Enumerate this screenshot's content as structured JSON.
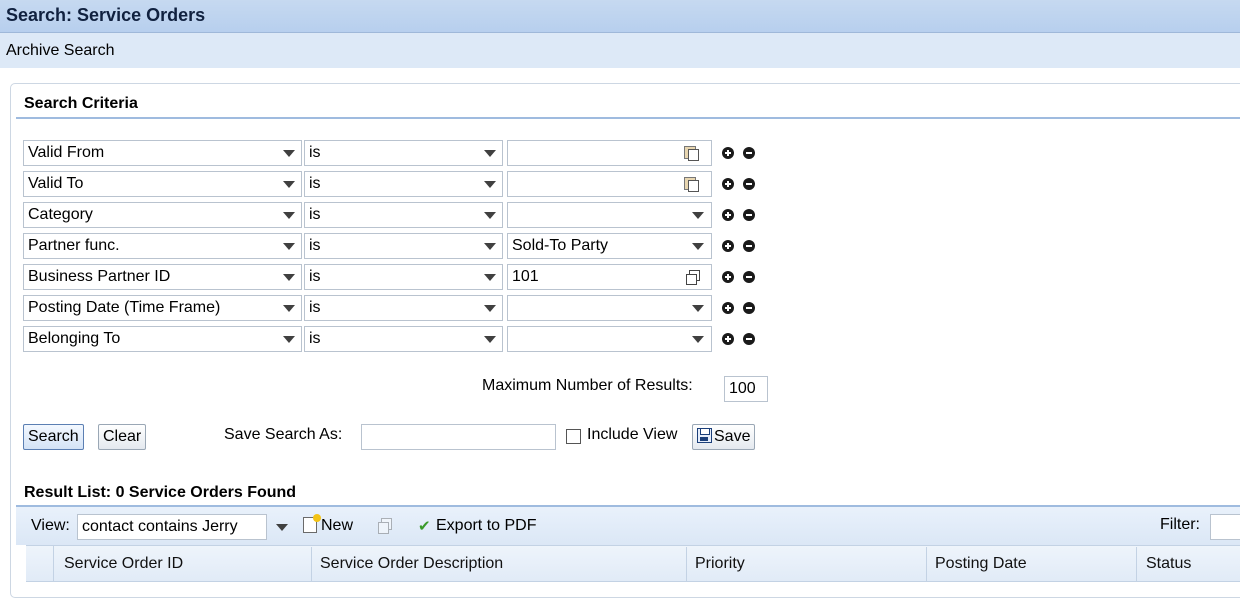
{
  "header": {
    "title": "Search: Service Orders",
    "subtitle": "Archive Search"
  },
  "search_criteria": {
    "title": "Search Criteria",
    "rows": [
      {
        "field": "Valid From",
        "operator": "is",
        "value": "",
        "value_type": "date"
      },
      {
        "field": "Valid To",
        "operator": "is",
        "value": "",
        "value_type": "date"
      },
      {
        "field": "Category",
        "operator": "is",
        "value": "",
        "value_type": "dropdown"
      },
      {
        "field": "Partner func.",
        "operator": "is",
        "value": "Sold-To Party",
        "value_type": "dropdown"
      },
      {
        "field": "Business Partner ID",
        "operator": "is",
        "value": "101",
        "value_type": "lookup"
      },
      {
        "field": "Posting Date (Time Frame)",
        "operator": "is",
        "value": "",
        "value_type": "dropdown"
      },
      {
        "field": "Belonging To",
        "operator": "is",
        "value": "",
        "value_type": "dropdown"
      }
    ],
    "max_results_label": "Maximum Number of Results:",
    "max_results_value": "100"
  },
  "actions": {
    "search_label": "Search",
    "clear_label": "Clear",
    "save_search_as_label": "Save Search As:",
    "save_search_as_value": "",
    "include_view_label": "Include View",
    "include_view_checked": false,
    "save_label": "Save"
  },
  "result_list": {
    "title": "Result List: 0 Service Orders Found",
    "view_label": "View:",
    "view_value": "contact contains Jerry",
    "new_label": "New",
    "export_label": "Export to PDF",
    "filter_label": "Filter:",
    "columns": [
      "Service Order ID",
      "Service Order Description",
      "Priority",
      "Posting Date",
      "Status"
    ],
    "rows": []
  },
  "icons": {
    "dropdown": "chevron-down-icon",
    "calendar": "calendar-icon",
    "lookup": "copy-icon",
    "add_row": "plus-circle-icon",
    "remove_row": "minus-circle-icon",
    "save": "floppy-icon",
    "new": "new-document-icon",
    "export": "checkmark-icon"
  },
  "colors": {
    "title_bar": "#c6d9f0",
    "sub_bar": "#dde9f7",
    "section_line": "#9fbbdf",
    "toolbar": "#dbe7f6",
    "export_check": "#3a9a2a"
  }
}
